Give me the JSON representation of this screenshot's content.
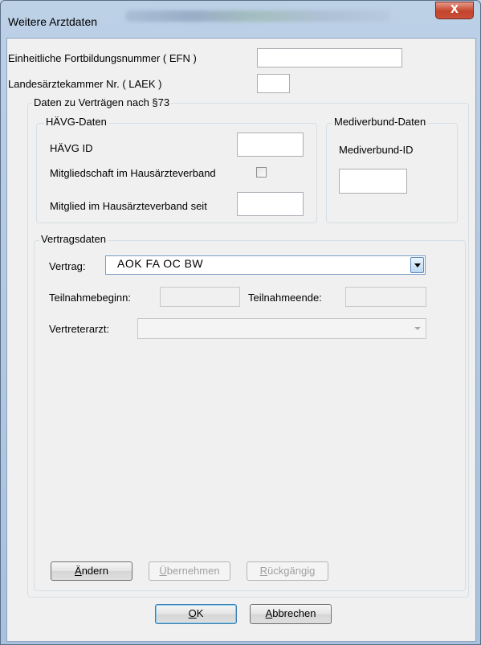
{
  "window": {
    "title": "Weitere Arztdaten",
    "close_glyph": "X"
  },
  "fields": {
    "efn_label": "Einheitliche Fortbildungsnummer ( EFN )",
    "efn_value": "",
    "laek_label": "Landesärztekammer Nr. ( LAEK )",
    "laek_value": ""
  },
  "vertraege_group": {
    "title": "Daten zu Verträgen nach §73"
  },
  "haevg": {
    "title": "HÄVG-Daten",
    "id_label": "HÄVG ID",
    "id_value": "",
    "mitgliedschaft_label": "Mitgliedschaft im Hausärzteverband",
    "mitgliedschaft_checked": false,
    "mitglied_seit_label": "Mitglied im Hausärzteverband seit",
    "mitglied_seit_value": ""
  },
  "mediverbund": {
    "title": "Mediverbund-Daten",
    "id_label": "Mediverbund-ID",
    "id_value": ""
  },
  "vertragsdaten": {
    "title": "Vertragsdaten",
    "vertrag_label": "Vertrag:",
    "vertrag_value": "AOK FA OC BW",
    "teilnahmebeginn_label": "Teilnahmebeginn:",
    "teilnahmebeginn_value": "",
    "teilnahmeende_label": "Teilnahmeende:",
    "teilnahmeende_value": "",
    "vertreterarzt_label": "Vertreterarzt:",
    "vertreterarzt_value": ""
  },
  "actions": {
    "aendern_prefix": "Ä",
    "aendern_rest": "ndern",
    "uebernehmen_prefix": "Ü",
    "uebernehmen_rest": "bernehmen",
    "rueckgaengig_prefix": "R",
    "rueckgaengig_rest": "ückgängig"
  },
  "dialog_buttons": {
    "ok_prefix": "O",
    "ok_rest": "K",
    "abbrechen_prefix": "A",
    "abbrechen_rest": "bbrechen"
  }
}
